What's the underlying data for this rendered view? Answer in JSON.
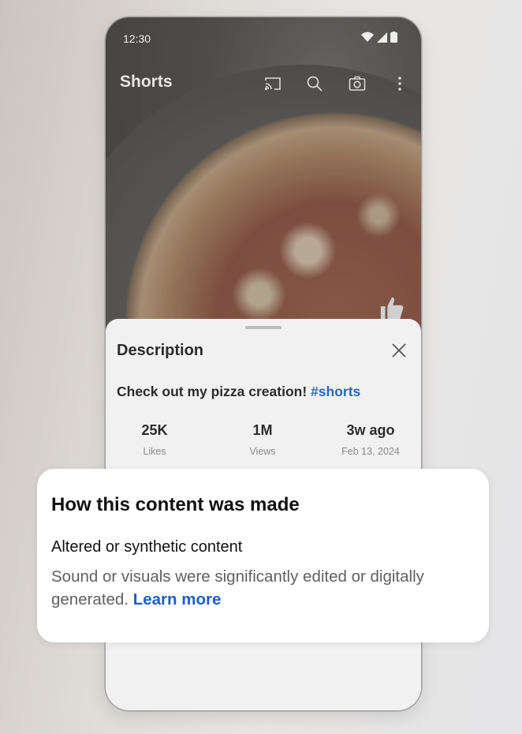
{
  "status_bar": {
    "time": "12:30",
    "icons": [
      "wifi-icon",
      "signal-icon",
      "battery-icon"
    ]
  },
  "app_bar": {
    "title": "Shorts",
    "icons": [
      "cast-icon",
      "search-icon",
      "camera-icon",
      "more-vert-icon"
    ]
  },
  "video": {
    "side_icon": "thumb-up-icon"
  },
  "description_sheet": {
    "title": "Description",
    "close_icon": "close-icon",
    "text": "Check out my pizza creation!",
    "hashtag": "#shorts",
    "stats": [
      {
        "value": "25K",
        "label": "Likes"
      },
      {
        "value": "1M",
        "label": "Views"
      },
      {
        "value": "3w ago",
        "label": "Feb 13, 2024"
      }
    ]
  },
  "disclosure_card": {
    "heading": "How this content was made",
    "subheading": "Altered or synthetic content",
    "body": "Sound or visuals were significantly edited or digitally generated.",
    "link": "Learn more"
  },
  "colors": {
    "link": "#1f5fc4",
    "hashtag": "#2f67b8",
    "card_bg": "#ffffff",
    "sheet_bg": "#f1f1f1"
  }
}
